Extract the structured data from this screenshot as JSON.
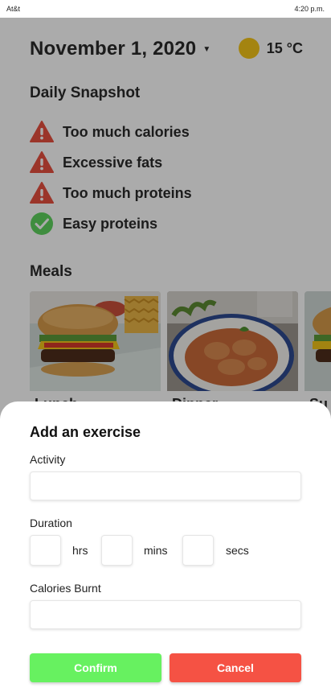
{
  "status_bar": {
    "carrier": "At&t",
    "time": "4:20 p.m."
  },
  "header": {
    "date": "November 1, 2020",
    "dropdown_icon": "caret-down-icon",
    "weather_icon": "sun-icon",
    "temperature": "15 °C"
  },
  "snapshot": {
    "title": "Daily Snapshot",
    "items": [
      {
        "label": "Too much calories",
        "icon": "warning-icon",
        "status": "warning"
      },
      {
        "label": "Excessive fats",
        "icon": "warning-icon",
        "status": "warning"
      },
      {
        "label": "Too much proteins",
        "icon": "warning-icon",
        "status": "warning"
      },
      {
        "label": "Easy proteins",
        "icon": "check-circle-icon",
        "status": "ok"
      }
    ]
  },
  "meals": {
    "title": "Meals",
    "cards": [
      {
        "label": "Lunch",
        "photo": "burger-fries-photo"
      },
      {
        "label": "Dinner",
        "photo": "ravioli-bowl-photo"
      },
      {
        "label": "Su",
        "photo": "burger-photo"
      }
    ]
  },
  "modal": {
    "title": "Add an exercise",
    "activity_label": "Activity",
    "activity_value": "",
    "duration_label": "Duration",
    "hrs_label": "hrs",
    "mins_label": "mins",
    "secs_label": "secs",
    "calories_label": "Calories Burnt",
    "calories_value": "",
    "confirm_label": "Confirm",
    "cancel_label": "Cancel"
  },
  "colors": {
    "warning": "#e8503f",
    "ok": "#5ed25e",
    "sun": "#f5c518",
    "confirm": "#67f160",
    "cancel": "#f55244"
  }
}
